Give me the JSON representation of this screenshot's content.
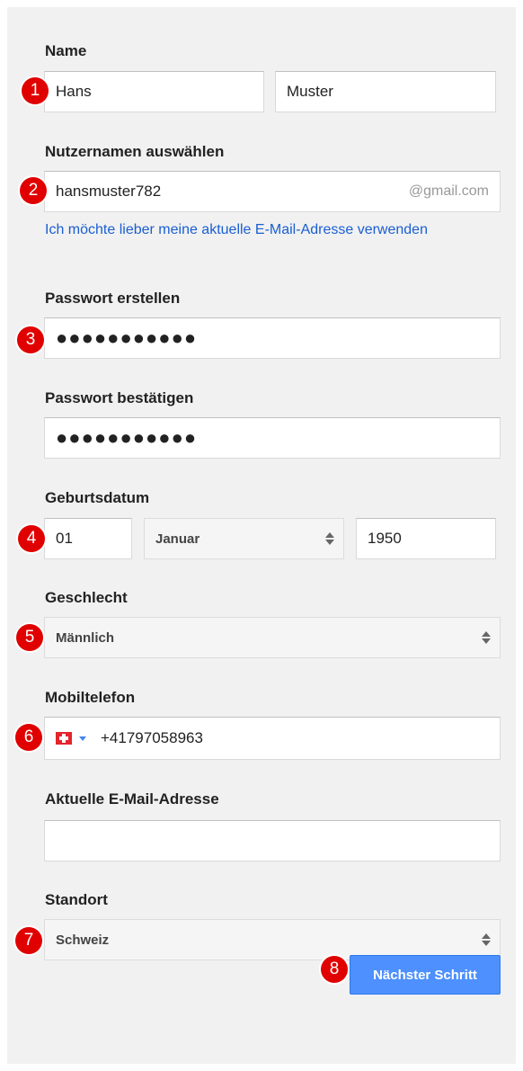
{
  "form": {
    "name": {
      "label": "Name",
      "first": "Hans",
      "last": "Muster"
    },
    "username": {
      "label": "Nutzernamen auswählen",
      "value": "hansmuster782",
      "suffix": "@gmail.com",
      "alt_link": "Ich möchte lieber meine aktuelle E-Mail-Adresse verwenden"
    },
    "password": {
      "label": "Passwort erstellen",
      "masked": "●●●●●●●●●●●"
    },
    "password_confirm": {
      "label": "Passwort bestätigen",
      "masked": "●●●●●●●●●●●"
    },
    "birthdate": {
      "label": "Geburtsdatum",
      "day": "01",
      "month": "Januar",
      "year": "1950"
    },
    "gender": {
      "label": "Geschlecht",
      "value": "Männlich"
    },
    "mobile": {
      "label": "Mobiltelefon",
      "value": "+41797058963",
      "country_icon": "swiss-flag-icon"
    },
    "current_email": {
      "label": "Aktuelle E-Mail-Adresse",
      "value": ""
    },
    "location": {
      "label": "Standort",
      "value": "Schweiz"
    },
    "next_button": "Nächster Schritt"
  },
  "badges": [
    "1",
    "2",
    "3",
    "4",
    "5",
    "6",
    "7",
    "8"
  ],
  "colors": {
    "badge": "#e00000",
    "link": "#1a5fd1",
    "button": "#4d90fe",
    "panel": "#f1f1f1"
  }
}
